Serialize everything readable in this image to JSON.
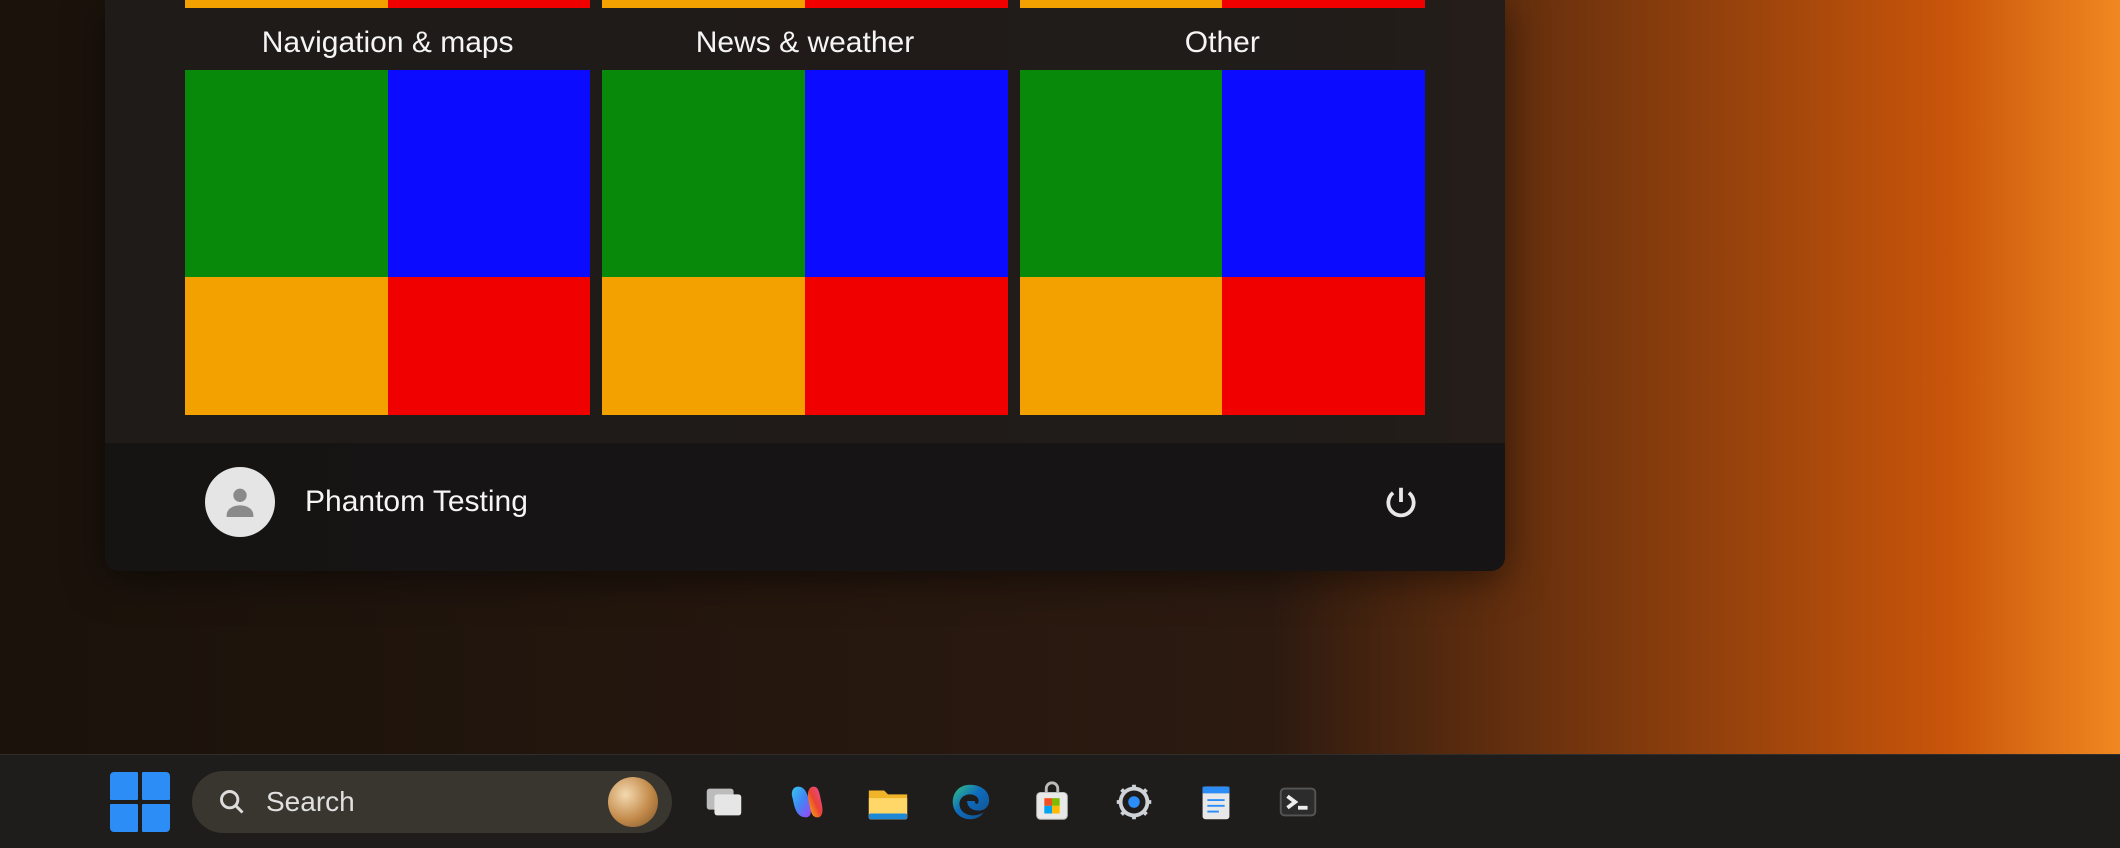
{
  "start_menu": {
    "categories": [
      {
        "label": "Navigation & maps"
      },
      {
        "label": "News & weather"
      },
      {
        "label": "Other"
      }
    ],
    "tile_colors": {
      "top_left": "#098909",
      "top_right": "#0b0bff",
      "bottom_left": "#f3a100",
      "bottom_right": "#f10000"
    },
    "user_name": "Phantom Testing",
    "power_icon": "power-icon"
  },
  "taskbar": {
    "search_placeholder": "Search",
    "search_highlight_icon": "nautilus-icon",
    "items": [
      {
        "name": "start-button",
        "label": "Start"
      },
      {
        "name": "task-view-icon",
        "label": "Task View"
      },
      {
        "name": "copilot-icon",
        "label": "Copilot"
      },
      {
        "name": "file-explorer-icon",
        "label": "File Explorer"
      },
      {
        "name": "edge-icon",
        "label": "Microsoft Edge"
      },
      {
        "name": "microsoft-store-icon",
        "label": "Microsoft Store"
      },
      {
        "name": "settings-icon",
        "label": "Settings"
      },
      {
        "name": "notepad-icon",
        "label": "Notepad"
      },
      {
        "name": "terminal-icon",
        "label": "Terminal"
      }
    ]
  }
}
